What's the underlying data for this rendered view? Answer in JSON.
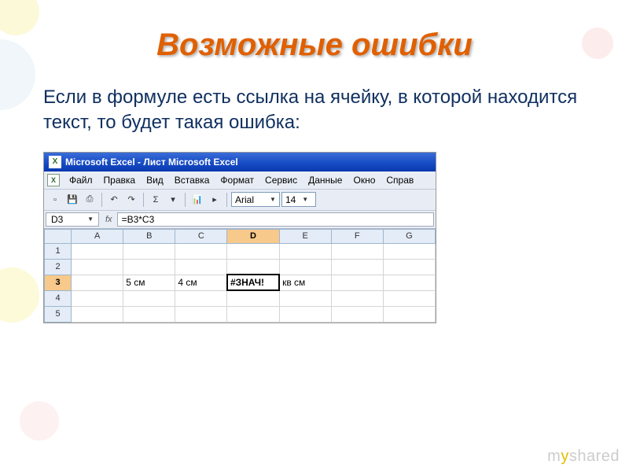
{
  "slide": {
    "title": "Возможные ошибки",
    "description": "Если в формуле есть ссылка на ячейку, в которой находится текст, то будет такая ошибка:"
  },
  "excel": {
    "titlebar": "Microsoft Excel - Лист Microsoft Excel",
    "menu": {
      "file": "Файл",
      "edit": "Правка",
      "view": "Вид",
      "insert": "Вставка",
      "format": "Формат",
      "tools": "Сервис",
      "data": "Данные",
      "window": "Окно",
      "help": "Справ"
    },
    "toolbar": {
      "font_name": "Arial",
      "font_size": "14"
    },
    "namebox": "D3",
    "fx_label": "fx",
    "formula": "=B3*C3",
    "columns": [
      "A",
      "B",
      "C",
      "D",
      "E",
      "F",
      "G"
    ],
    "active_col_index": 3,
    "rows": [
      "1",
      "2",
      "3",
      "4",
      "5"
    ],
    "active_row_index": 2,
    "cells": {
      "B3": "5 см",
      "C3": "4 см",
      "D3": "#ЗНАЧ!",
      "E3": "кв см"
    }
  },
  "watermark": "myshared"
}
